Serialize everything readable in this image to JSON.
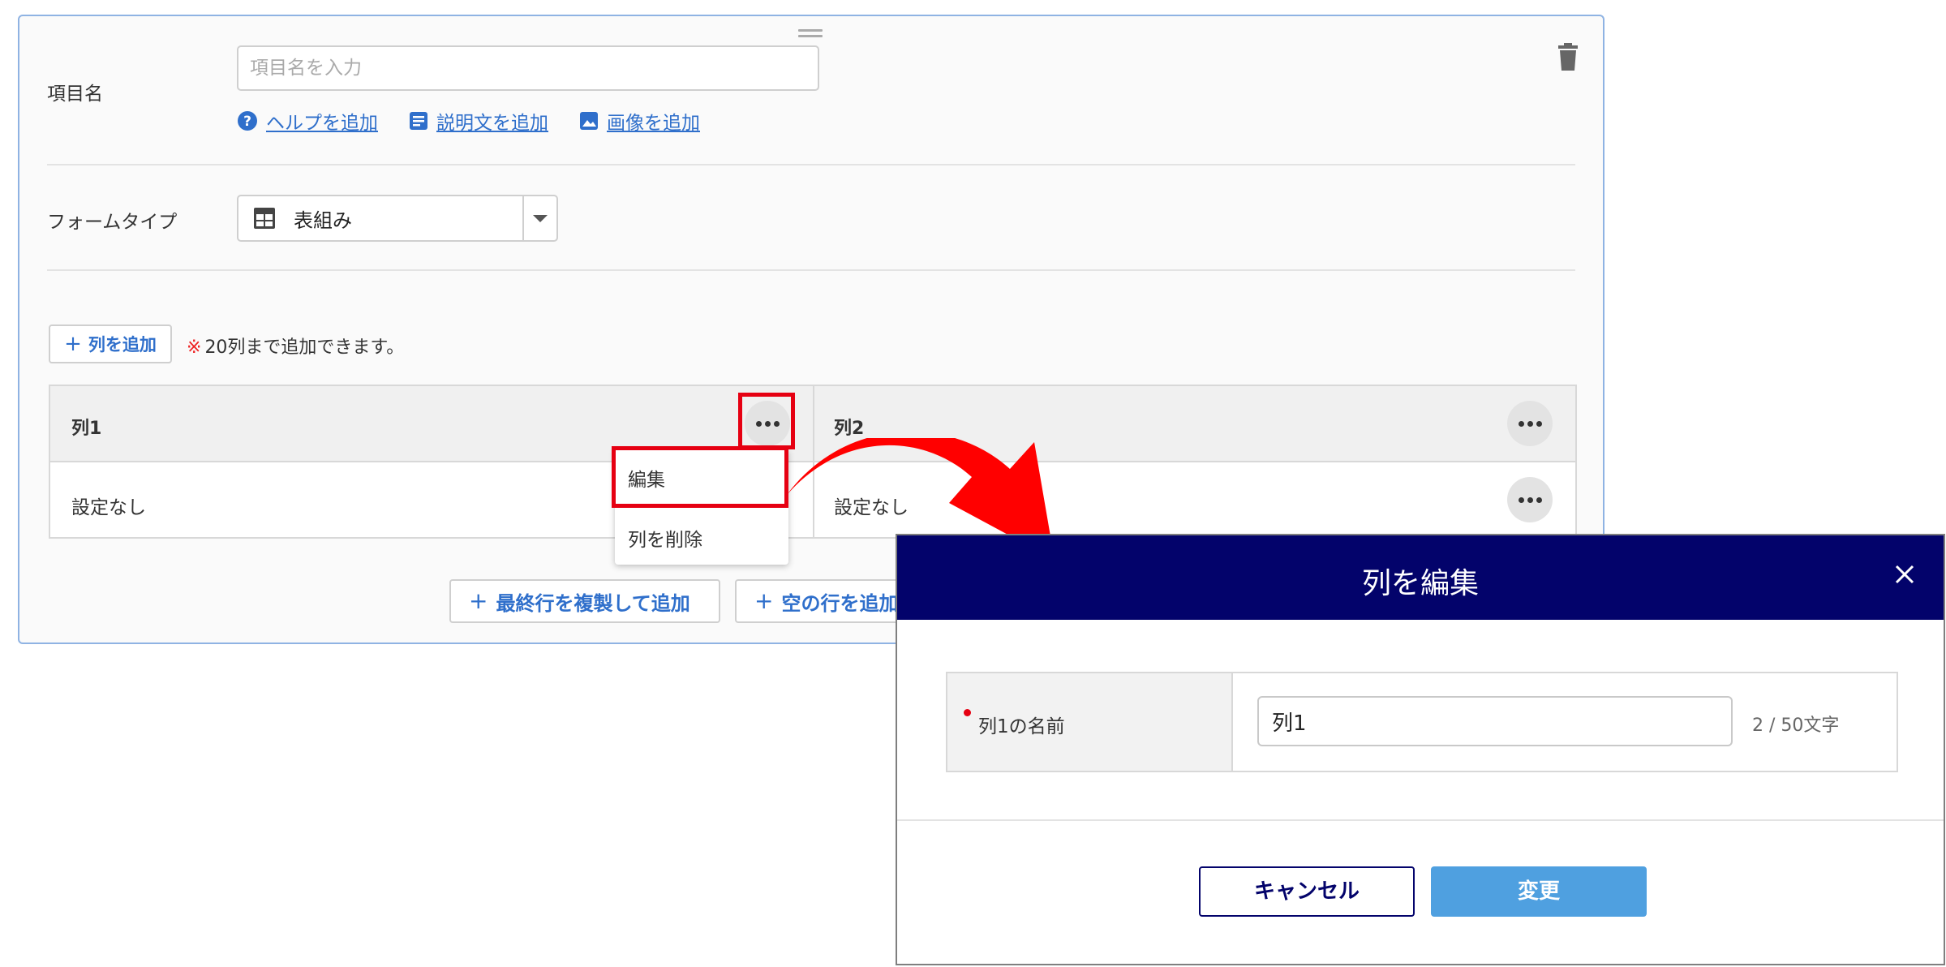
{
  "form": {
    "item_name_label": "項目名",
    "item_name_placeholder": "項目名を入力",
    "links": {
      "help": "ヘルプを追加",
      "description": "説明文を追加",
      "image": "画像を追加"
    },
    "form_type_label": "フォームタイプ",
    "form_type_value": "表組み",
    "add_column_label": "列を追加",
    "note_mark": "※",
    "note_text": "20列まで追加できます。",
    "columns": [
      {
        "title": "列1",
        "cell": "設定なし"
      },
      {
        "title": "列2",
        "cell": "設定なし"
      }
    ],
    "add_copy_row_label": "最終行を複製して追加",
    "add_empty_row_label": "空の行を追加"
  },
  "menu": {
    "edit": "編集",
    "delete": "列を削除"
  },
  "modal": {
    "title": "列を編集",
    "field_label": "列1の名前",
    "field_value": "列1",
    "char_count": "2 / 50文字",
    "cancel": "キャンセル",
    "submit": "変更"
  },
  "colors": {
    "accent_link": "#2f6fcb",
    "modal_header": "#03036b",
    "submit_button": "#4fa0e0",
    "highlight": "#e60012"
  }
}
